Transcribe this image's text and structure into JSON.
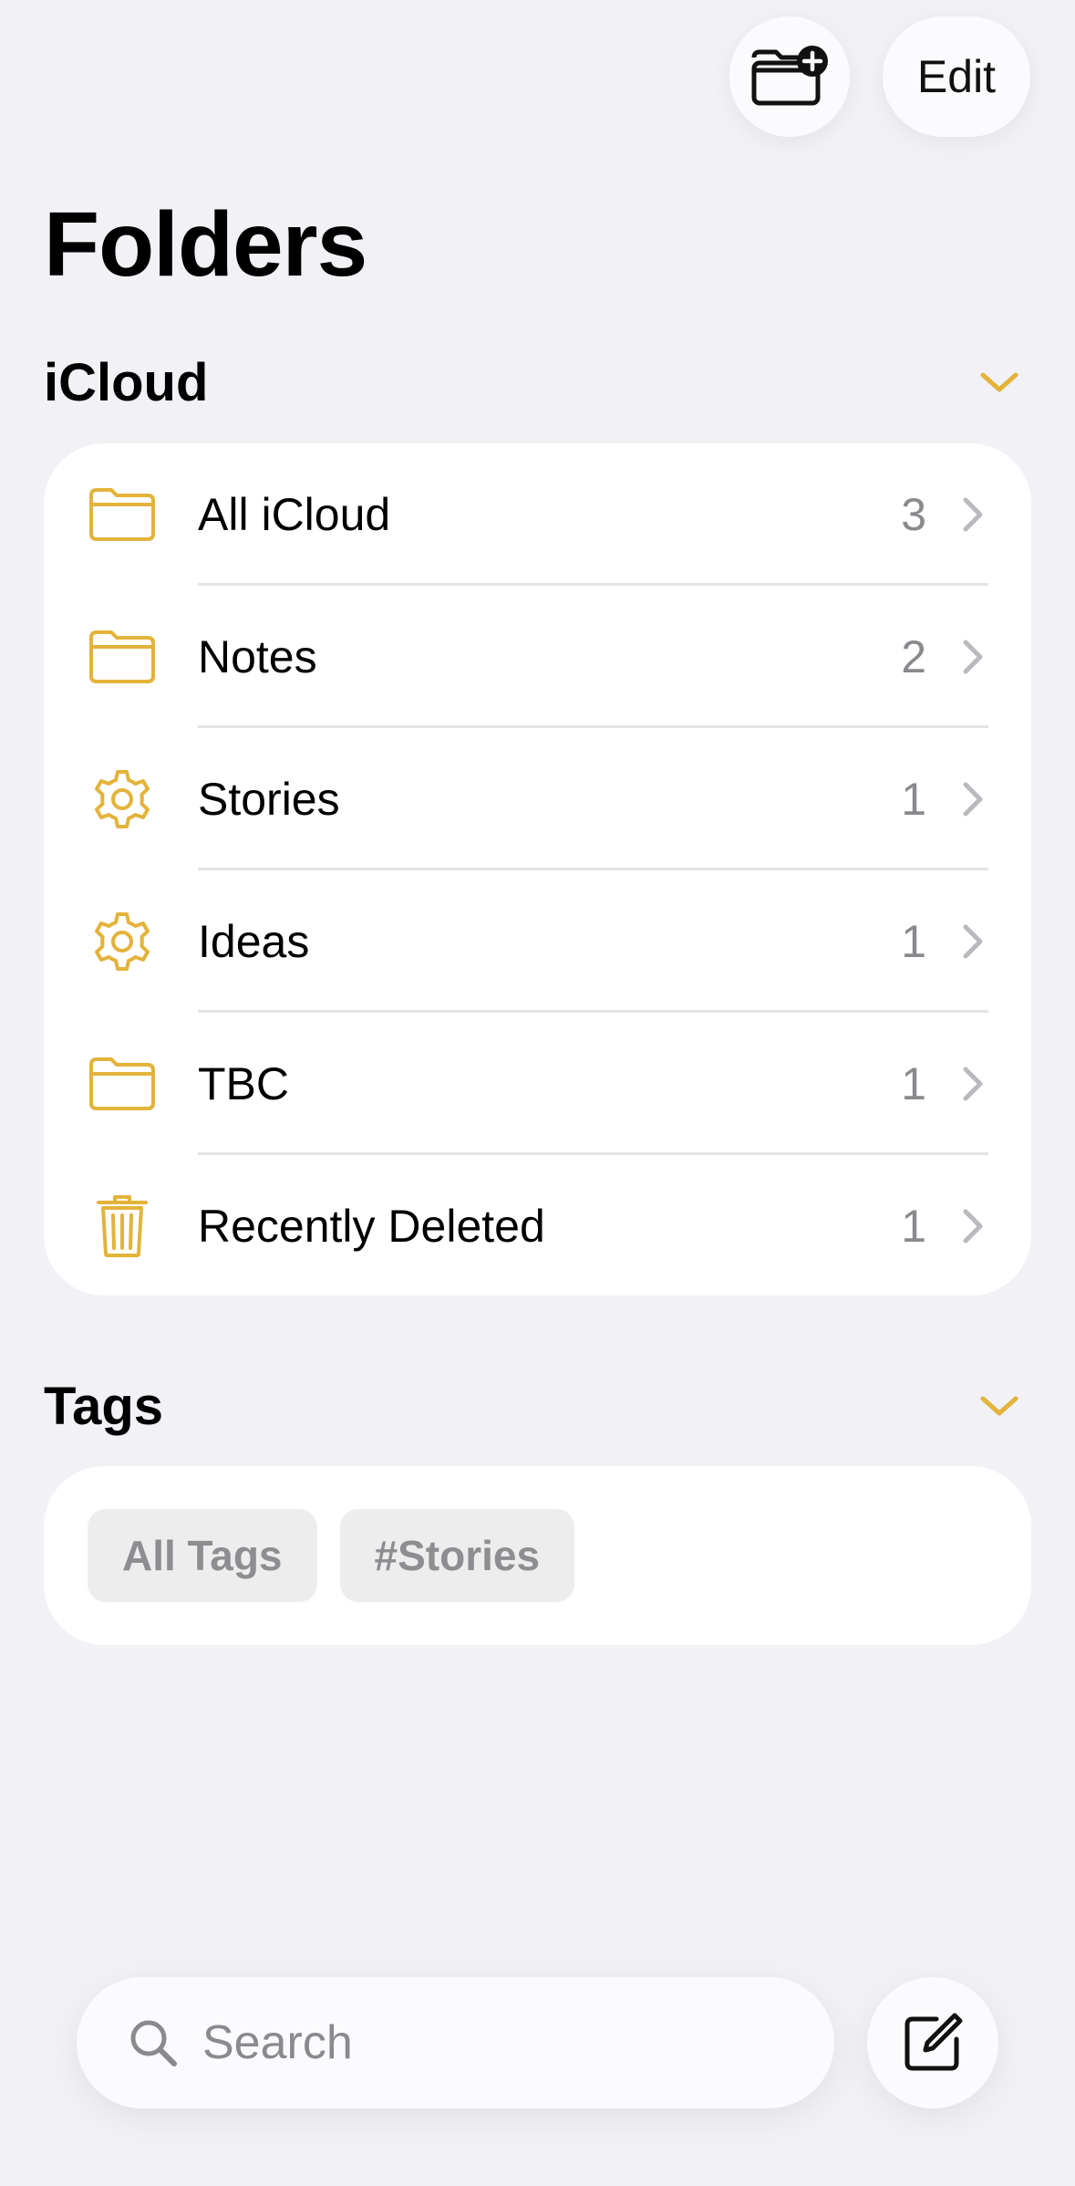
{
  "header": {
    "edit_label": "Edit",
    "new_folder_icon": "folder-plus-icon"
  },
  "title": "Folders",
  "icloud": {
    "title": "iCloud",
    "folders": [
      {
        "label": "All iCloud",
        "count": "3",
        "icon": "folder-icon"
      },
      {
        "label": "Notes",
        "count": "2",
        "icon": "folder-icon"
      },
      {
        "label": "Stories",
        "count": "1",
        "icon": "gear-icon"
      },
      {
        "label": "Ideas",
        "count": "1",
        "icon": "gear-icon"
      },
      {
        "label": "TBC",
        "count": "1",
        "icon": "folder-icon"
      },
      {
        "label": "Recently Deleted",
        "count": "1",
        "icon": "trash-icon"
      }
    ]
  },
  "tags": {
    "title": "Tags",
    "items": [
      "All Tags",
      "#Stories"
    ]
  },
  "search": {
    "placeholder": "Search"
  },
  "colors": {
    "accent": "#E3B33A",
    "background": "#F1F1F6",
    "card": "#FFFFFF",
    "secondary_text": "#8A8A8E"
  }
}
